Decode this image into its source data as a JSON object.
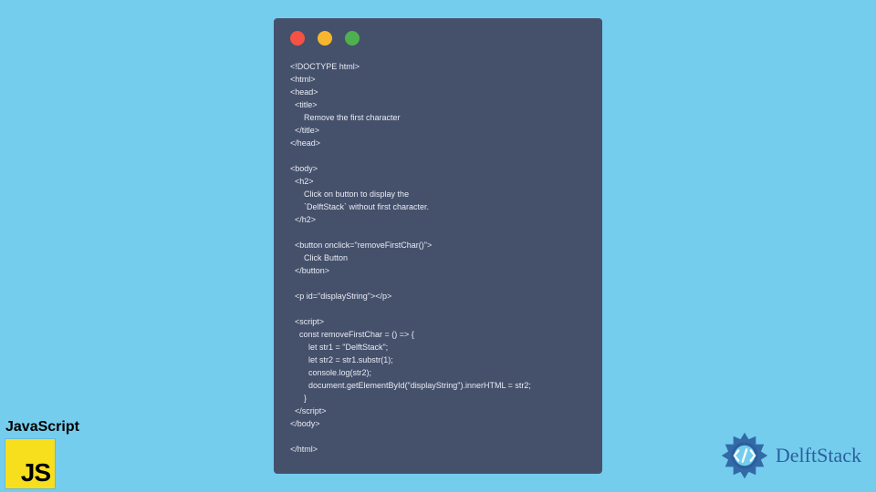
{
  "jsBadge": {
    "label": "JavaScript"
  },
  "brand": {
    "text": "DelftStack"
  },
  "code": {
    "lines": [
      "<!DOCTYPE html>",
      "<html>",
      "<head>",
      "  <title>",
      "      Remove the first character",
      "  </title>",
      "</head>",
      "",
      "<body>",
      "  <h2>",
      "      Click on button to display the",
      "      `DelftStack` without first character.",
      "  </h2>",
      "",
      "  <button onclick=\"removeFirstChar()\">",
      "      Click Button",
      "  </button>",
      "",
      "  <p id=\"displayString\"></p>",
      "",
      "  <script>",
      "    const removeFirstChar = () => {",
      "        let str1 = \"DelftStack\";",
      "        let str2 = str1.substr(1);",
      "        console.log(str2);",
      "        document.getElementById(\"displayString\").innerHTML = str2;",
      "      }",
      "  </script>",
      "</body>",
      "",
      "</html>"
    ]
  }
}
